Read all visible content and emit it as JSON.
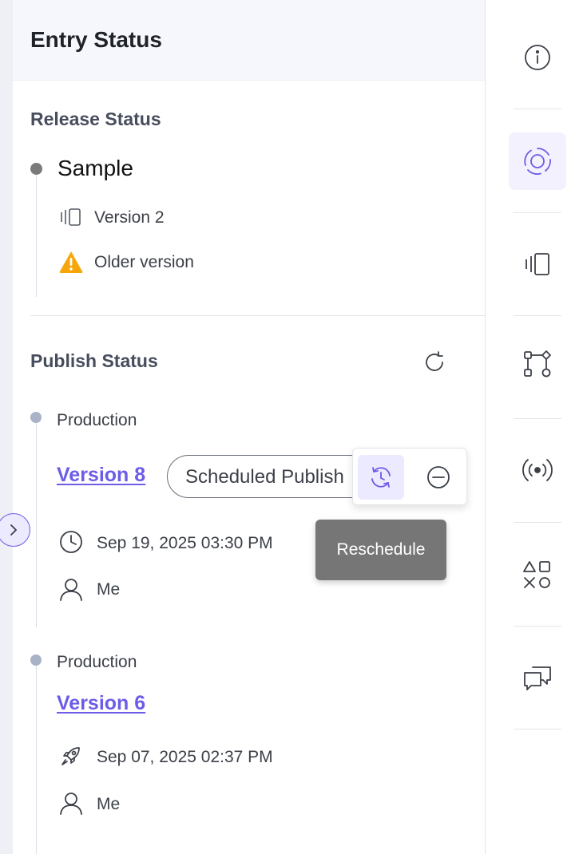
{
  "panel": {
    "title": "Entry Status",
    "release": {
      "title": "Release Status",
      "name": "Sample",
      "version": "Version 2",
      "warning": "Older version",
      "version_icon": "versions-icon",
      "warning_icon": "warning-triangle-icon"
    },
    "publish": {
      "title": "Publish Status",
      "refresh_icon": "refresh-icon",
      "entries": [
        {
          "environment": "Production",
          "version": "Version 8",
          "status": "Scheduled Publish",
          "date": "Sep 19, 2025 03:30 PM",
          "user": "Me",
          "date_icon": "clock-icon",
          "user_icon": "user-icon"
        },
        {
          "environment": "Production",
          "version": "Version 6",
          "date": "Sep 07, 2025 02:37 PM",
          "user": "Me",
          "date_icon": "rocket-icon",
          "user_icon": "user-icon"
        }
      ]
    },
    "actions": {
      "reschedule_icon": "reschedule-icon",
      "cancel_icon": "minus-circle-icon",
      "tooltip": "Reschedule"
    }
  },
  "rail": {
    "items": [
      {
        "icon": "info-icon",
        "active": false
      },
      {
        "icon": "status-icon",
        "active": true
      },
      {
        "icon": "versions-icon",
        "active": false
      },
      {
        "icon": "workflow-icon",
        "active": false
      },
      {
        "icon": "broadcast-icon",
        "active": false
      },
      {
        "icon": "shapes-icon",
        "active": false
      },
      {
        "icon": "comments-icon",
        "active": false
      }
    ]
  },
  "colors": {
    "accent": "#6c5ce7",
    "accent_bg": "#eceaff",
    "warning": "#f6a609",
    "tooltip_bg": "#767676"
  }
}
